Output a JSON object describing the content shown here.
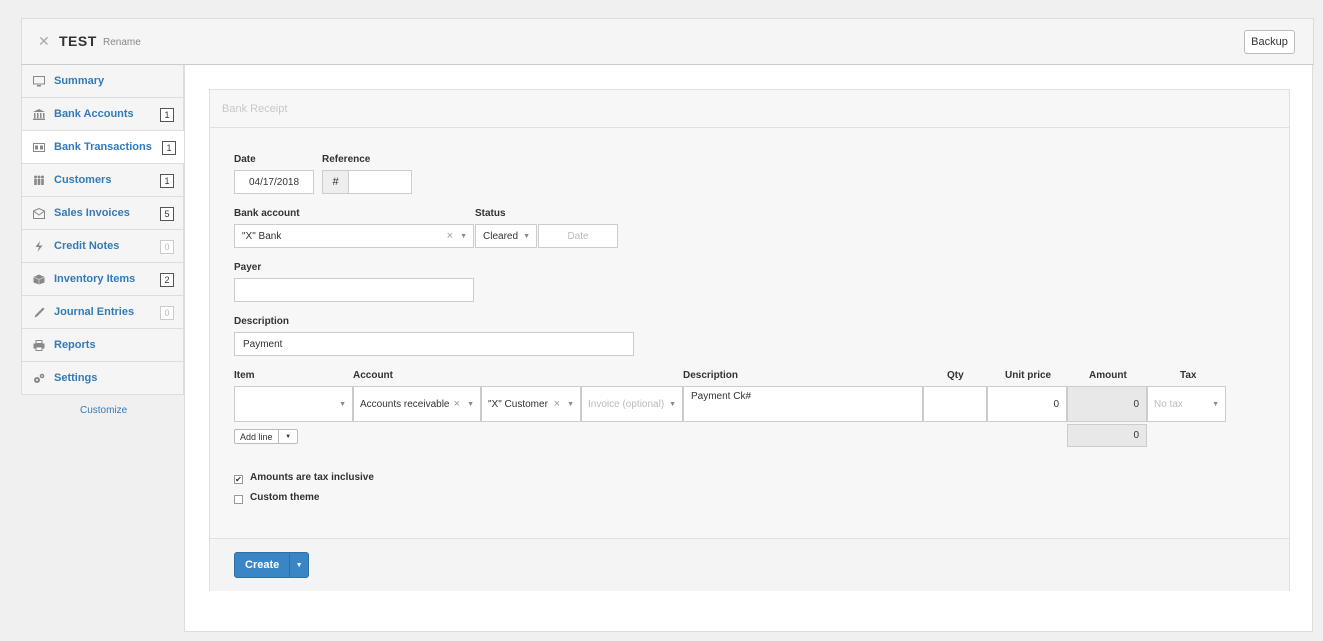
{
  "header": {
    "close_icon": "close-icon",
    "business_name": "TEST",
    "rename_label": "Rename",
    "backup_label": "Backup"
  },
  "sidebar": {
    "items": [
      {
        "label": "Summary",
        "icon": "monitor-icon",
        "badge": null,
        "active": false
      },
      {
        "label": "Bank Accounts",
        "icon": "bank-icon",
        "badge": "1",
        "active": false
      },
      {
        "label": "Bank Transactions",
        "icon": "transactions-icon",
        "badge": "1",
        "active": true
      },
      {
        "label": "Customers",
        "icon": "people-icon",
        "badge": "1",
        "active": false
      },
      {
        "label": "Sales Invoices",
        "icon": "invoice-icon",
        "badge": "5",
        "active": false
      },
      {
        "label": "Credit Notes",
        "icon": "lightning-icon",
        "badge": "0",
        "active": false
      },
      {
        "label": "Inventory Items",
        "icon": "box-icon",
        "badge": "2",
        "active": false
      },
      {
        "label": "Journal Entries",
        "icon": "pen-icon",
        "badge": "0",
        "active": false
      },
      {
        "label": "Reports",
        "icon": "printer-icon",
        "badge": null,
        "active": false
      },
      {
        "label": "Settings",
        "icon": "gears-icon",
        "badge": null,
        "active": false
      }
    ],
    "customize_label": "Customize"
  },
  "form": {
    "title": "Bank Receipt",
    "date_label": "Date",
    "date_value": "04/17/2018",
    "reference_label": "Reference",
    "reference_prefix": "#",
    "reference_value": "",
    "bank_account_label": "Bank account",
    "bank_account_value": "\"X\" Bank",
    "status_label": "Status",
    "status_value": "Cleared",
    "status_date_placeholder": "Date",
    "payer_label": "Payer",
    "payer_value": "",
    "description_label": "Description",
    "description_value": "Payment",
    "lines": {
      "headers": {
        "item": "Item",
        "account": "Account",
        "description": "Description",
        "qty": "Qty",
        "unit_price": "Unit price",
        "amount": "Amount",
        "tax": "Tax"
      },
      "row": {
        "item": "",
        "account": "Accounts receivable",
        "customer": "\"X\" Customer",
        "invoice_placeholder": "Invoice (optional)",
        "description": "Payment Ck#",
        "qty": "",
        "unit_price": "0",
        "amount": "0",
        "tax_placeholder": "No tax"
      },
      "total": "0",
      "add_line_label": "Add line"
    },
    "amounts_tax_inclusive_label": "Amounts are tax inclusive",
    "amounts_tax_inclusive_checked": true,
    "custom_theme_label": "Custom theme",
    "custom_theme_checked": false,
    "create_label": "Create"
  }
}
